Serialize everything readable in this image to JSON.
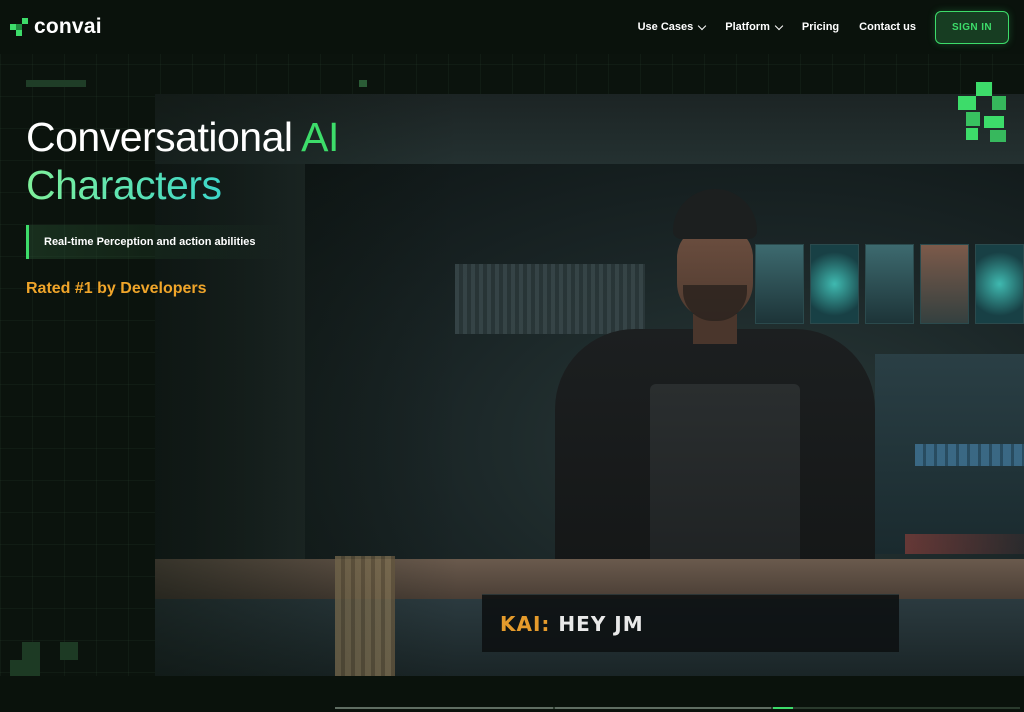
{
  "brand": {
    "name": "convai",
    "accent": "#3ddc6a"
  },
  "nav": {
    "items": [
      {
        "label": "Use Cases",
        "dropdown": true
      },
      {
        "label": "Platform",
        "dropdown": true
      },
      {
        "label": "Pricing",
        "dropdown": false
      },
      {
        "label": "Contact us",
        "dropdown": false
      }
    ],
    "signin_label": "SIGN IN"
  },
  "hero": {
    "title_part1": "Conversational ",
    "title_part2": "AI",
    "title_line2": "Characters",
    "tagline": "Real-time Perception and action abilities",
    "rated": "Rated #1 by Developers"
  },
  "video": {
    "subtitle_speaker": "KAI:",
    "subtitle_text": "HEY JM"
  },
  "colors": {
    "background": "#0b130d",
    "rated": "#f0a52a",
    "subtitle_speaker": "#e59b2c"
  }
}
